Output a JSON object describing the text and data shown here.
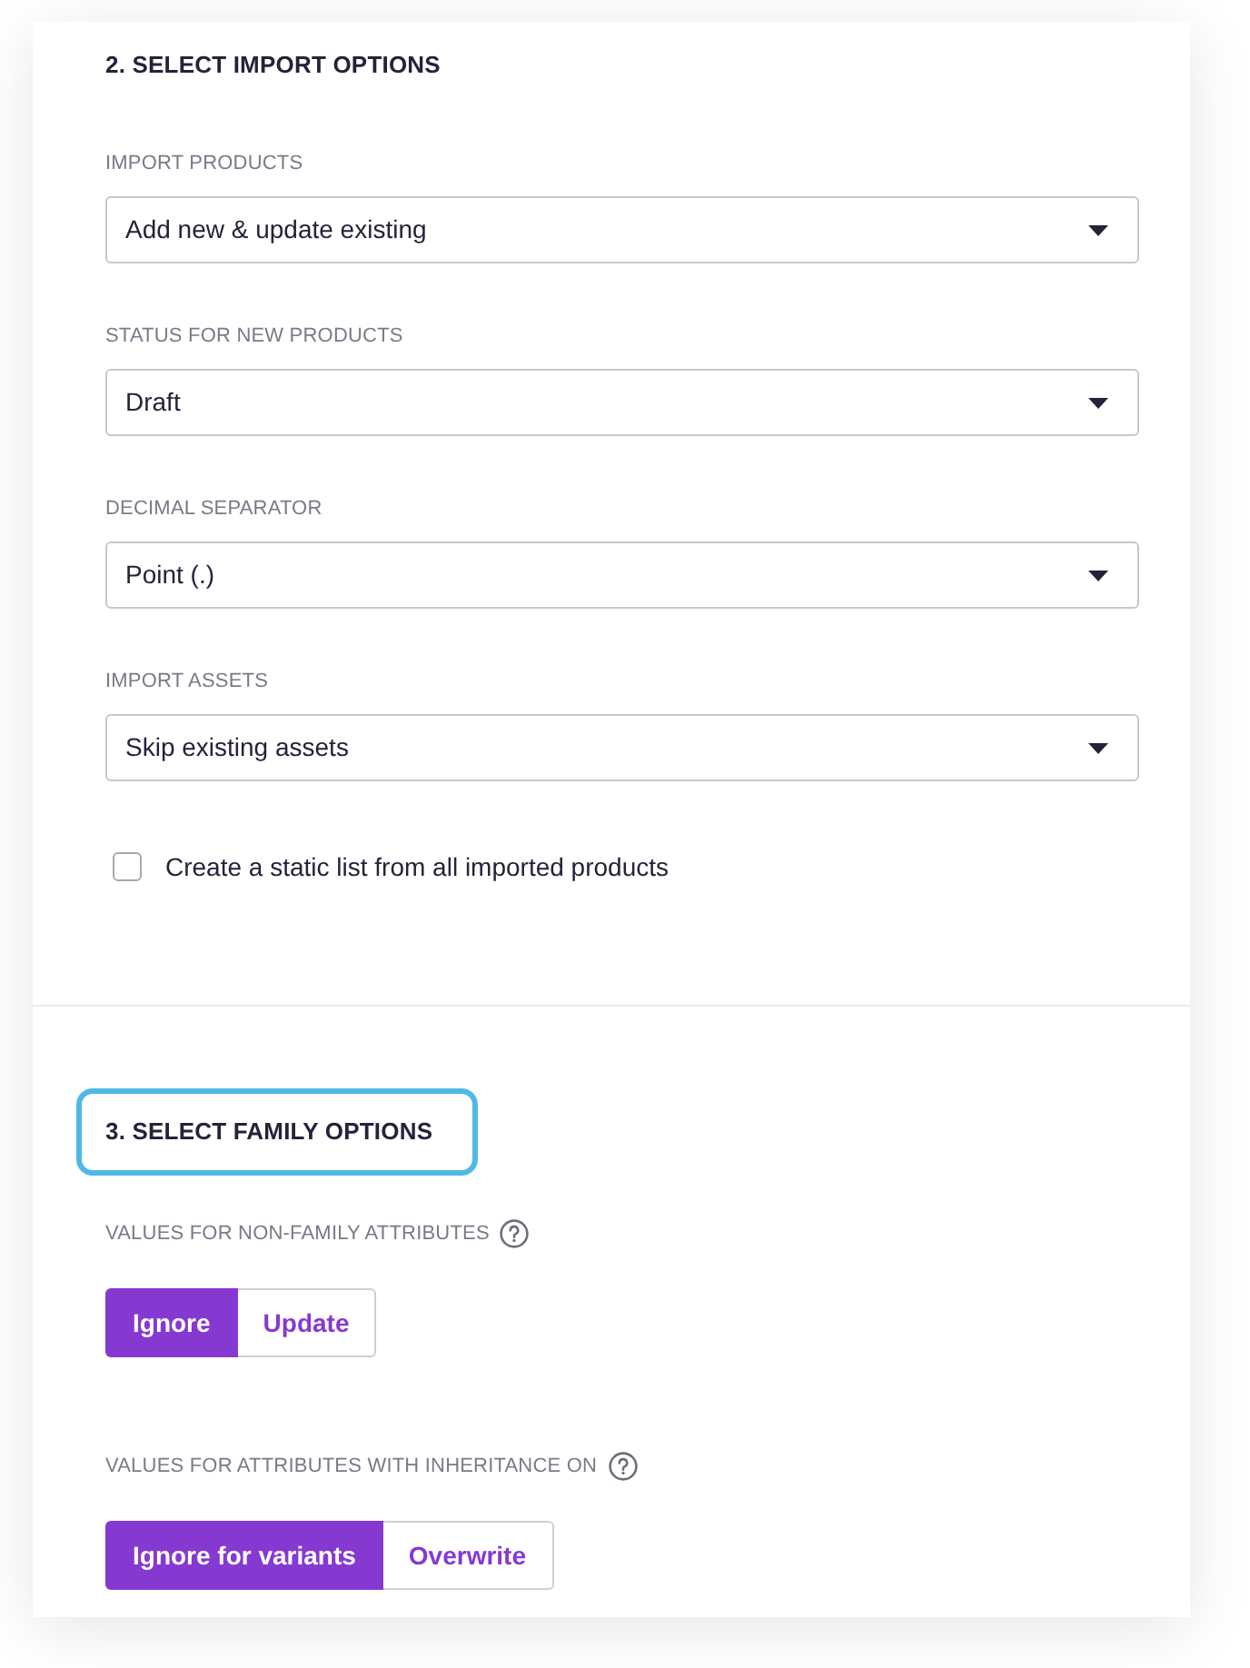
{
  "sections": [
    {
      "heading": "2. SELECT IMPORT OPTIONS",
      "highlighted": false,
      "fields": [
        {
          "kind": "select",
          "label": "IMPORT PRODUCTS",
          "value": "Add new & update existing"
        },
        {
          "kind": "select",
          "label": "STATUS FOR NEW PRODUCTS",
          "value": "Draft"
        },
        {
          "kind": "select",
          "label": "DECIMAL SEPARATOR",
          "value": "Point (.)"
        },
        {
          "kind": "select",
          "label": "IMPORT ASSETS",
          "value": "Skip existing assets"
        },
        {
          "kind": "checkbox",
          "label": "Create a static list from all imported products",
          "checked": false
        }
      ]
    },
    {
      "heading": "3. SELECT FAMILY OPTIONS",
      "highlighted": true,
      "fields": [
        {
          "kind": "toggle",
          "label": "VALUES FOR NON-FAMILY ATTRIBUTES",
          "help": true,
          "options": [
            {
              "label": "Ignore",
              "selected": true
            },
            {
              "label": "Update",
              "selected": false
            }
          ]
        },
        {
          "kind": "toggle",
          "label": "VALUES FOR ATTRIBUTES WITH INHERITANCE ON",
          "help": true,
          "options": [
            {
              "label": "Ignore for variants",
              "selected": true
            },
            {
              "label": "Overwrite",
              "selected": false
            }
          ]
        }
      ]
    }
  ]
}
